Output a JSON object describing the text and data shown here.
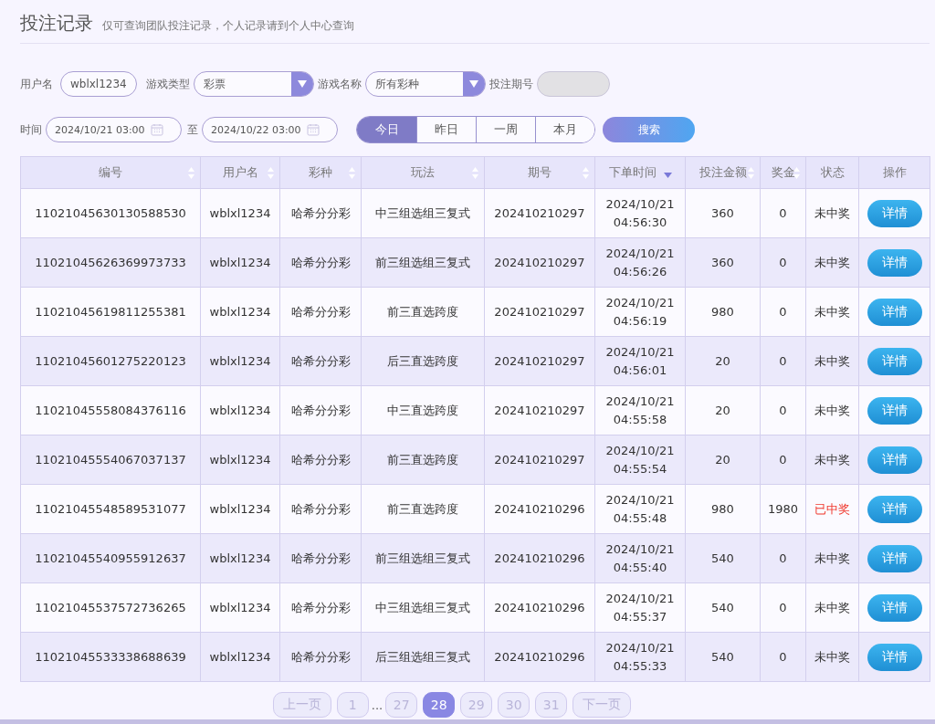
{
  "header": {
    "title": "投注记录",
    "subtitle": "仅可查询团队投注记录，个人记录请到个人中心查询"
  },
  "filters": {
    "username_label": "用户名",
    "username": "wblxl1234",
    "game_type_label": "游戏类型",
    "game_type": "彩票",
    "game_name_label": "游戏名称",
    "game_name": "所有彩种",
    "issue_label": "投注期号",
    "time_label": "时间",
    "time_from": "2024/10/21 03:00",
    "to_label": "至",
    "time_to": "2024/10/22 03:00",
    "quick_ranges": [
      {
        "label": "今日",
        "selected": true
      },
      {
        "label": "昨日",
        "selected": false
      },
      {
        "label": "一周",
        "selected": false
      },
      {
        "label": "本月",
        "selected": false
      }
    ],
    "search_button": "搜索"
  },
  "table": {
    "columns": [
      {
        "label": "编号",
        "kind": "sortable"
      },
      {
        "label": "用户名",
        "kind": "sortable"
      },
      {
        "label": "彩种",
        "kind": "sortable"
      },
      {
        "label": "玩法",
        "kind": "sortable"
      },
      {
        "label": "期号",
        "kind": "sortable"
      },
      {
        "label": "下单时间",
        "kind": "descending"
      },
      {
        "label": "投注金额",
        "kind": "sortable"
      },
      {
        "label": "奖金",
        "kind": "sortable"
      },
      {
        "label": "状态",
        "kind": "plain"
      },
      {
        "label": "操作",
        "kind": "plain"
      }
    ],
    "rows": [
      {
        "id": "11021045630130588530",
        "user": "wblxl1234",
        "lottery": "哈希分分彩",
        "play": "中三组选组三复式",
        "issue": "202410210297",
        "date": "2024/10/21",
        "time": "04:56:30",
        "amount": "360",
        "prize": "0",
        "status": "未中奖",
        "won": false,
        "action": "详情"
      },
      {
        "id": "11021045626369973733",
        "user": "wblxl1234",
        "lottery": "哈希分分彩",
        "play": "前三组选组三复式",
        "issue": "202410210297",
        "date": "2024/10/21",
        "time": "04:56:26",
        "amount": "360",
        "prize": "0",
        "status": "未中奖",
        "won": false,
        "action": "详情"
      },
      {
        "id": "11021045619811255381",
        "user": "wblxl1234",
        "lottery": "哈希分分彩",
        "play": "前三直选跨度",
        "issue": "202410210297",
        "date": "2024/10/21",
        "time": "04:56:19",
        "amount": "980",
        "prize": "0",
        "status": "未中奖",
        "won": false,
        "action": "详情"
      },
      {
        "id": "11021045601275220123",
        "user": "wblxl1234",
        "lottery": "哈希分分彩",
        "play": "后三直选跨度",
        "issue": "202410210297",
        "date": "2024/10/21",
        "time": "04:56:01",
        "amount": "20",
        "prize": "0",
        "status": "未中奖",
        "won": false,
        "action": "详情"
      },
      {
        "id": "11021045558084376116",
        "user": "wblxl1234",
        "lottery": "哈希分分彩",
        "play": "中三直选跨度",
        "issue": "202410210297",
        "date": "2024/10/21",
        "time": "04:55:58",
        "amount": "20",
        "prize": "0",
        "status": "未中奖",
        "won": false,
        "action": "详情"
      },
      {
        "id": "11021045554067037137",
        "user": "wblxl1234",
        "lottery": "哈希分分彩",
        "play": "前三直选跨度",
        "issue": "202410210297",
        "date": "2024/10/21",
        "time": "04:55:54",
        "amount": "20",
        "prize": "0",
        "status": "未中奖",
        "won": false,
        "action": "详情"
      },
      {
        "id": "11021045548589531077",
        "user": "wblxl1234",
        "lottery": "哈希分分彩",
        "play": "前三直选跨度",
        "issue": "202410210296",
        "date": "2024/10/21",
        "time": "04:55:48",
        "amount": "980",
        "prize": "1980",
        "status": "已中奖",
        "won": true,
        "action": "详情"
      },
      {
        "id": "11021045540955912637",
        "user": "wblxl1234",
        "lottery": "哈希分分彩",
        "play": "前三组选组三复式",
        "issue": "202410210296",
        "date": "2024/10/21",
        "time": "04:55:40",
        "amount": "540",
        "prize": "0",
        "status": "未中奖",
        "won": false,
        "action": "详情"
      },
      {
        "id": "11021045537572736265",
        "user": "wblxl1234",
        "lottery": "哈希分分彩",
        "play": "中三组选组三复式",
        "issue": "202410210296",
        "date": "2024/10/21",
        "time": "04:55:37",
        "amount": "540",
        "prize": "0",
        "status": "未中奖",
        "won": false,
        "action": "详情"
      },
      {
        "id": "11021045533338688639",
        "user": "wblxl1234",
        "lottery": "哈希分分彩",
        "play": "后三组选组三复式",
        "issue": "202410210296",
        "date": "2024/10/21",
        "time": "04:55:33",
        "amount": "540",
        "prize": "0",
        "status": "未中奖",
        "won": false,
        "action": "详情"
      }
    ]
  },
  "pagination": {
    "prev": "上一页",
    "items": [
      {
        "kind": "page",
        "label": "1",
        "selected": false
      },
      {
        "kind": "ellipsis",
        "label": "..."
      },
      {
        "kind": "page",
        "label": "27",
        "selected": false
      },
      {
        "kind": "page",
        "label": "28",
        "selected": true
      },
      {
        "kind": "page",
        "label": "29",
        "selected": false
      },
      {
        "kind": "page",
        "label": "30",
        "selected": false
      },
      {
        "kind": "page",
        "label": "31",
        "selected": false
      }
    ],
    "next": "下一页"
  }
}
